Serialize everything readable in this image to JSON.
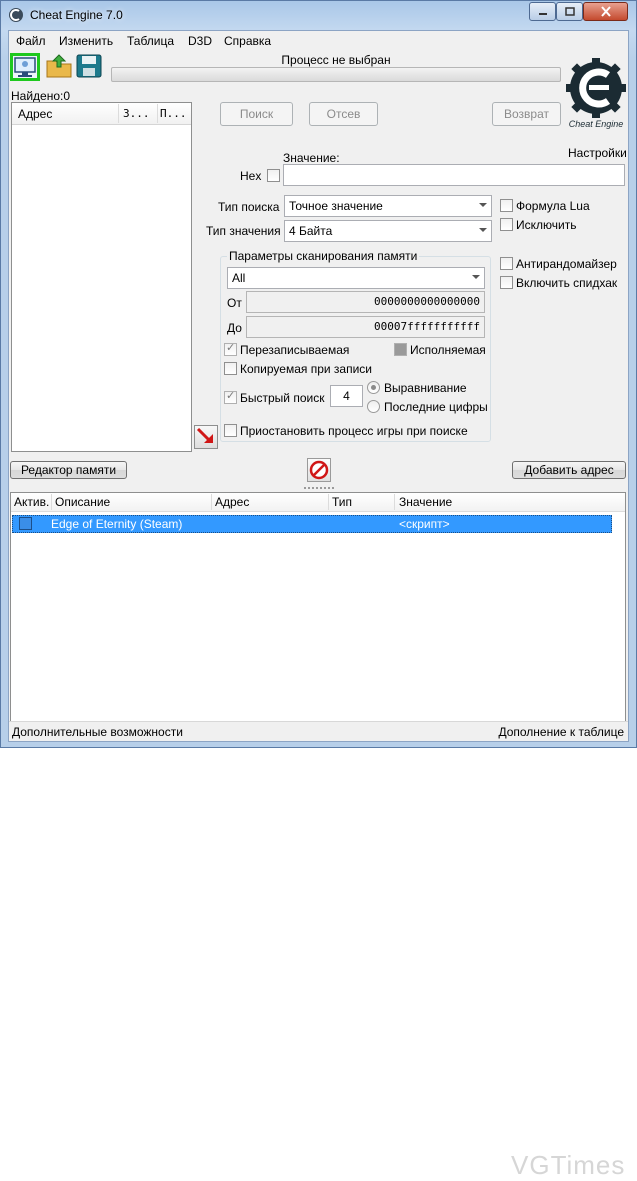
{
  "window": {
    "title": "Cheat Engine 7.0",
    "caption_buttons": [
      "minimize",
      "maximize",
      "close"
    ]
  },
  "menu": [
    "Файл",
    "Изменить",
    "Таблица",
    "D3D",
    "Справка"
  ],
  "toolbar": {
    "icons": [
      "open-process-icon",
      "open-file-icon",
      "save-icon"
    ]
  },
  "process": {
    "label": "Процесс не выбран",
    "progress": 0
  },
  "found": {
    "label": "Найдено:0"
  },
  "logo": {
    "text": "Cheat Engine",
    "settings_label": "Настройки"
  },
  "results": {
    "columns": [
      "Адрес",
      "З...",
      "П..."
    ]
  },
  "scan_buttons": {
    "first": "Поиск",
    "next": "Отсев",
    "undo": "Возврат"
  },
  "value": {
    "label": "Значение:",
    "hex_label": "Hex",
    "input": ""
  },
  "scan_type": {
    "label": "Тип поиска",
    "selected": "Точное значение"
  },
  "value_type": {
    "label": "Тип значения",
    "selected": "4 Байта"
  },
  "options_right": {
    "lua_formula": "Формула Lua",
    "exclude": "Исключить",
    "unrandomizer": "Антирандомайзер",
    "speedhack": "Включить спидхак"
  },
  "memory_scan": {
    "title": "Параметры сканирования памяти",
    "region": "All",
    "from_label": "От",
    "from_value": "0000000000000000",
    "to_label": "До",
    "to_value": "00007fffffffffff",
    "writable": "Перезаписываемая",
    "executable": "Исполняемая",
    "copy_on_write": "Копируемая при записи",
    "fast_scan": "Быстрый поиск",
    "fast_scan_value": "4",
    "alignment": "Выравнивание",
    "last_digits": "Последние цифры",
    "pause": "Приостановить процесс игры при поиске"
  },
  "bottom_buttons": {
    "memory_view": "Редактор памяти",
    "add_address": "Добавить адрес"
  },
  "table": {
    "columns": [
      "Актив.",
      "Описание",
      "Адрес",
      "Тип",
      "Значение"
    ],
    "rows": [
      {
        "active": false,
        "description": "Edge of Eternity (Steam)",
        "address": "",
        "type": "",
        "value": "<скрипт>"
      }
    ]
  },
  "status": {
    "left": "Дополнительные возможности",
    "right": "Дополнение к таблице"
  },
  "watermark": "VGTimes",
  "colors": {
    "selection": "#3399ff",
    "highlight_border": "#1ec81e"
  }
}
